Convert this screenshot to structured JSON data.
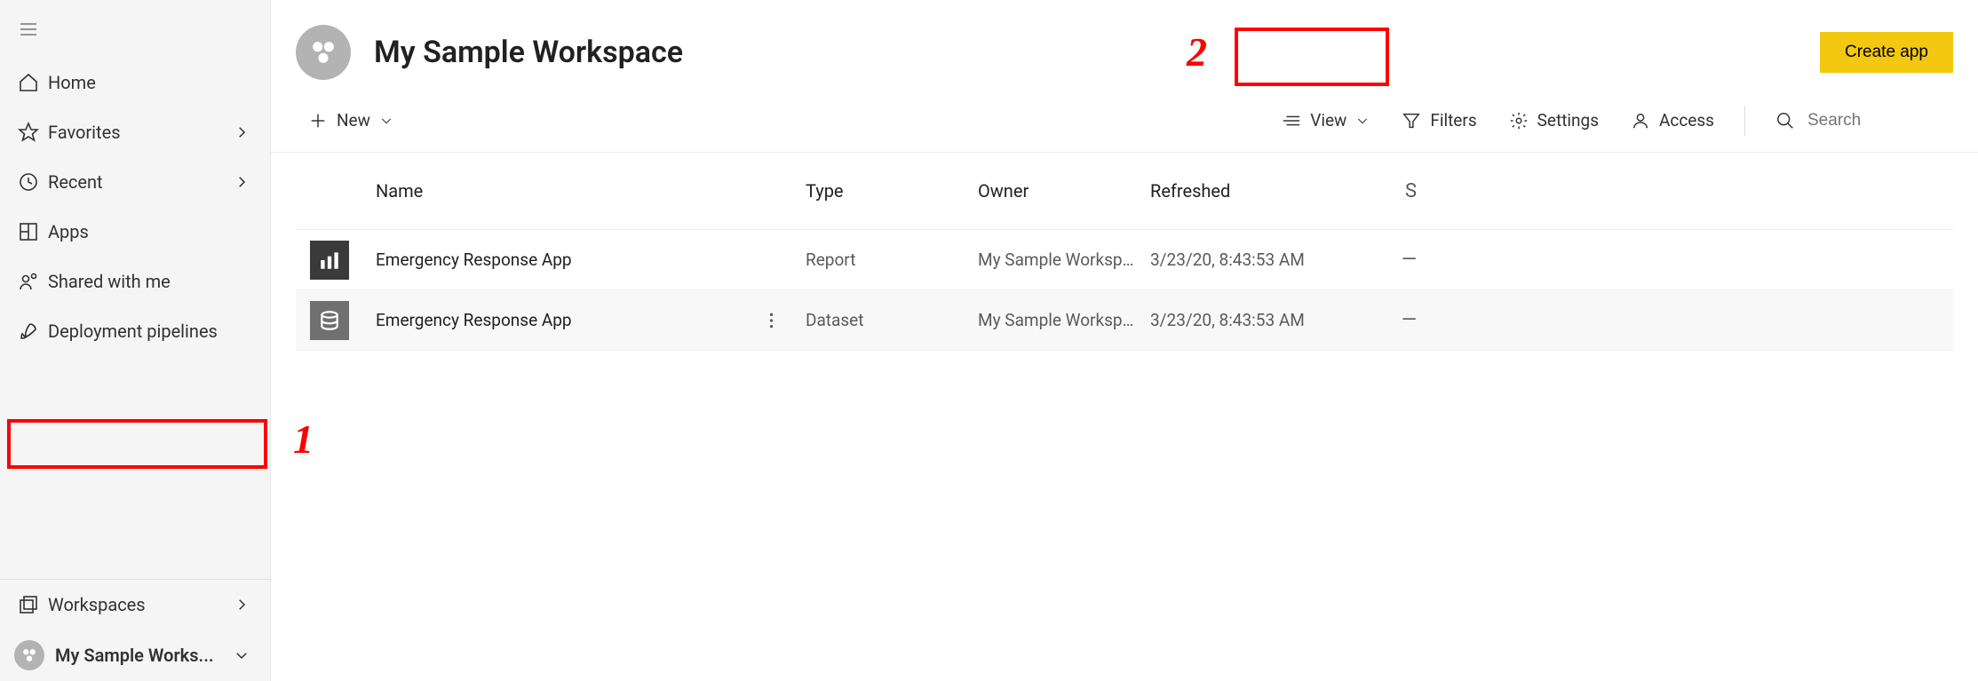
{
  "sidebar": {
    "items": [
      {
        "label": "Home"
      },
      {
        "label": "Favorites"
      },
      {
        "label": "Recent"
      },
      {
        "label": "Apps"
      },
      {
        "label": "Shared with me"
      },
      {
        "label": "Deployment pipelines"
      }
    ],
    "workspaces_label": "Workspaces",
    "current_workspace": "My Sample Works..."
  },
  "header": {
    "title": "My Sample Workspace",
    "create_app_label": "Create app"
  },
  "toolbar": {
    "new_label": "New",
    "view_label": "View",
    "filters_label": "Filters",
    "settings_label": "Settings",
    "access_label": "Access",
    "search_placeholder": "Search"
  },
  "table": {
    "columns": {
      "name": "Name",
      "type": "Type",
      "owner": "Owner",
      "refreshed": "Refreshed",
      "sensitivity": "S"
    },
    "rows": [
      {
        "name": "Emergency Response App",
        "type": "Report",
        "owner": "My Sample Workspace",
        "refreshed": "3/23/20, 8:43:53 AM",
        "sensitivity": "—",
        "kind": "report",
        "show_more": false
      },
      {
        "name": "Emergency Response App",
        "type": "Dataset",
        "owner": "My Sample Workspace",
        "refreshed": "3/23/20, 8:43:53 AM",
        "sensitivity": "—",
        "kind": "dataset",
        "show_more": true
      }
    ]
  },
  "annotations": {
    "label1": "1",
    "label2": "2"
  }
}
